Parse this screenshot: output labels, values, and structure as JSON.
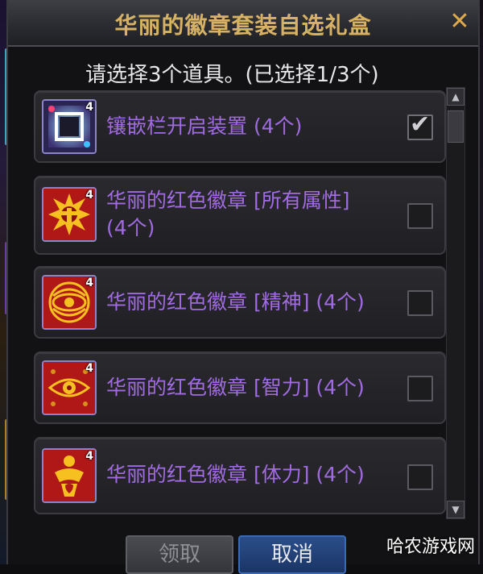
{
  "dialog": {
    "title": "华丽的徽章套装自选礼盒",
    "close_symbol": "✕",
    "instruction": "请选择3个道具。(已选择1/3个)"
  },
  "items": [
    {
      "name": "镶嵌栏开启装置 (4个)",
      "name_line2": "",
      "quantity": "4",
      "checked": true,
      "icon": "socket-opener-icon"
    },
    {
      "name": "华丽的红色徽章 [所有属性]",
      "name_line2": "(4个)",
      "quantity": "4",
      "checked": false,
      "icon": "red-emblem-all-stats-icon"
    },
    {
      "name": "华丽的红色徽章 [精神] (4个)",
      "name_line2": "",
      "quantity": "4",
      "checked": false,
      "icon": "red-emblem-spirit-icon"
    },
    {
      "name": "华丽的红色徽章 [智力] (4个)",
      "name_line2": "",
      "quantity": "4",
      "checked": false,
      "icon": "red-emblem-intelligence-icon"
    },
    {
      "name": "华丽的红色徽章 [体力] (4个)",
      "name_line2": "",
      "quantity": "4",
      "checked": false,
      "icon": "red-emblem-vitality-icon"
    }
  ],
  "buttons": {
    "claim": "领取",
    "cancel": "取消"
  },
  "watermark": "哈农游戏网",
  "colors": {
    "title_gold": "#d7b264",
    "item_purple": "#a06be0",
    "cancel_blue": "#2a4e8a"
  }
}
